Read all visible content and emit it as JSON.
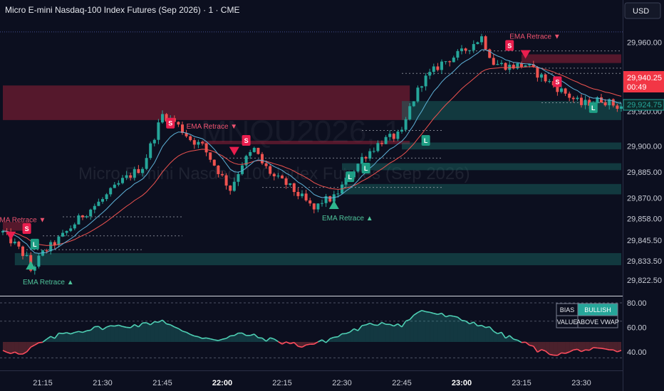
{
  "header": {
    "title": "Micro E-mini Nasdaq-100 Index Futures (Sep 2026) · 1 · CME",
    "currency": "USD",
    "watermark_symbol": "MNQU2026, 1",
    "watermark_name": "Micro E-mini Nasdaq-100 Index Futures (Sep 2026)"
  },
  "price_panel": {
    "last_price": "29,940.25",
    "countdown": "00:49",
    "ema_value": "29,924.75"
  },
  "status_table": {
    "bias_label": "BIAS",
    "bias_value": "BULLISH",
    "value_label": "VALUE",
    "value_value": "ABOVE VWAP"
  },
  "colors": {
    "background": "#0c0f1f",
    "bull": "#26a69a",
    "bear": "#ef5350",
    "signal_sell": "#e91e4e",
    "signal_buy": "#1e9e84",
    "ema_fast": "#5fb3d9",
    "ema_slow": "#ef5350"
  },
  "chart_data": {
    "type": "candlestick",
    "price_axis": {
      "ylim": [
        29815,
        29968
      ],
      "ticks": [
        29960,
        29940.25,
        29924.75,
        29920,
        29900,
        29885,
        29870,
        29858,
        29845.5,
        29833.5,
        29822.5
      ],
      "tick_labels": [
        "29,960.00",
        "29,940.25",
        "29,924.75",
        "29,920.00",
        "29,900.00",
        "29,885.00",
        "29,870.00",
        "29,858.00",
        "29,845.50",
        "29,833.50",
        "29,822.50"
      ]
    },
    "time_axis": {
      "xlim": [
        "21:05",
        "23:40"
      ],
      "ticks": [
        "21:15",
        "21:30",
        "21:45",
        "22:00",
        "22:15",
        "22:30",
        "22:45",
        "23:00",
        "23:15",
        "23:30"
      ],
      "bold_ticks": [
        "22:00",
        "23:00"
      ]
    },
    "waypoints": [
      [
        "21:05",
        29850
      ],
      [
        "21:08",
        29843
      ],
      [
        "21:11",
        29835
      ],
      [
        "21:12",
        29828
      ],
      [
        "21:15",
        29838
      ],
      [
        "21:20",
        29848
      ],
      [
        "21:25",
        29860
      ],
      [
        "21:30",
        29869
      ],
      [
        "21:35",
        29880
      ],
      [
        "21:40",
        29888
      ],
      [
        "21:43",
        29906
      ],
      [
        "21:45",
        29918
      ],
      [
        "21:48",
        29914
      ],
      [
        "21:52",
        29904
      ],
      [
        "21:55",
        29900
      ],
      [
        "22:00",
        29882
      ],
      [
        "22:02",
        29875
      ],
      [
        "22:05",
        29890
      ],
      [
        "22:08",
        29898
      ],
      [
        "22:10",
        29890
      ],
      [
        "22:13",
        29882
      ],
      [
        "22:16",
        29878
      ],
      [
        "22:20",
        29870
      ],
      [
        "22:23",
        29863
      ],
      [
        "22:25",
        29868
      ],
      [
        "22:28",
        29870
      ],
      [
        "22:31",
        29880
      ],
      [
        "22:35",
        29893
      ],
      [
        "22:40",
        29903
      ],
      [
        "22:45",
        29907
      ],
      [
        "22:47",
        29922
      ],
      [
        "22:50",
        29937
      ],
      [
        "22:55",
        29948
      ],
      [
        "23:00",
        29954
      ],
      [
        "23:05",
        29963
      ],
      [
        "23:08",
        29948
      ],
      [
        "23:12",
        29946
      ],
      [
        "23:16",
        29947
      ],
      [
        "23:20",
        29940
      ],
      [
        "23:25",
        29932
      ],
      [
        "23:30",
        29924
      ],
      [
        "23:35",
        29927
      ],
      [
        "23:39",
        29923
      ]
    ],
    "zones": [
      {
        "kind": "supply",
        "from": "21:05",
        "to": "22:47",
        "price_high": 29935,
        "price_low": 29915
      },
      {
        "kind": "supply",
        "from": "21:05",
        "to": "21:12",
        "price_high": 29856,
        "price_low": 29851
      },
      {
        "kind": "supply",
        "from": "21:55",
        "to": "22:47",
        "price_high": 29903,
        "price_low": 29901
      },
      {
        "kind": "supply",
        "from": "23:15",
        "to": "23:40",
        "price_high": 29953,
        "price_low": 29948
      },
      {
        "kind": "demand",
        "from": "21:08",
        "to": "23:40",
        "price_high": 29838,
        "price_low": 29831
      },
      {
        "kind": "demand",
        "from": "22:45",
        "to": "23:40",
        "price_high": 29926,
        "price_low": 29915
      },
      {
        "kind": "demand",
        "from": "22:45",
        "to": "23:40",
        "price_high": 29902,
        "price_low": 29898
      },
      {
        "kind": "demand",
        "from": "22:30",
        "to": "23:40",
        "price_high": 29890,
        "price_low": 29886
      },
      {
        "kind": "demand",
        "from": "22:30",
        "to": "23:40",
        "price_high": 29878,
        "price_low": 29872
      }
    ],
    "signals": [
      {
        "type": "S",
        "time": "21:11",
        "price": 29852
      },
      {
        "type": "L",
        "time": "21:13",
        "price": 29843
      },
      {
        "type": "S",
        "time": "21:47",
        "price": 29913
      },
      {
        "type": "S",
        "time": "22:06",
        "price": 29903
      },
      {
        "type": "L",
        "time": "22:32",
        "price": 29882
      },
      {
        "type": "L",
        "time": "22:36",
        "price": 29887
      },
      {
        "type": "L",
        "time": "22:51",
        "price": 29903
      },
      {
        "type": "S",
        "time": "23:12",
        "price": 29958
      },
      {
        "type": "S",
        "time": "23:24",
        "price": 29937
      },
      {
        "type": "L",
        "time": "23:33",
        "price": 29922
      }
    ],
    "retrace_labels": [
      {
        "text": "EMA Retrace ▼",
        "time": "23:12",
        "price": 29962,
        "kind": "bear"
      },
      {
        "text": "EMA Retrace ▼",
        "time": "21:51",
        "price": 29910,
        "kind": "bear"
      },
      {
        "text": "EMA Retrace ▼",
        "time": "21:03",
        "price": 29856,
        "kind": "bear"
      },
      {
        "text": "EMA Retrace ▲",
        "time": "22:25",
        "price": 29857,
        "kind": "bull"
      },
      {
        "text": "EMA Retrace ▲",
        "time": "21:10",
        "price": 29820,
        "kind": "bull"
      }
    ],
    "triangles": [
      {
        "dir": "down",
        "time": "23:16",
        "price": 29953
      },
      {
        "dir": "down",
        "time": "22:03",
        "price": 29897
      },
      {
        "dir": "down",
        "time": "21:07",
        "price": 29848
      },
      {
        "dir": "up",
        "time": "22:28",
        "price": 29866
      },
      {
        "dir": "up",
        "time": "21:12",
        "price": 29831
      }
    ],
    "oscillator": {
      "ylim": [
        30,
        80
      ],
      "ticks": [
        80,
        60,
        40
      ],
      "tick_labels": [
        "80.00",
        "60.00",
        "40.00"
      ],
      "level_lines": [
        80,
        65,
        35
      ],
      "waypoints": [
        [
          "21:05",
          42
        ],
        [
          "21:10",
          37
        ],
        [
          "21:13",
          45
        ],
        [
          "21:20",
          55
        ],
        [
          "21:30",
          60
        ],
        [
          "21:40",
          62
        ],
        [
          "21:45",
          66
        ],
        [
          "21:50",
          56
        ],
        [
          "21:55",
          52
        ],
        [
          "22:00",
          50
        ],
        [
          "22:05",
          55
        ],
        [
          "22:10",
          51
        ],
        [
          "22:15",
          48
        ],
        [
          "22:20",
          45
        ],
        [
          "22:25",
          48
        ],
        [
          "22:30",
          54
        ],
        [
          "22:35",
          60
        ],
        [
          "22:40",
          64
        ],
        [
          "22:45",
          62
        ],
        [
          "22:50",
          74
        ],
        [
          "22:55",
          70
        ],
        [
          "23:00",
          66
        ],
        [
          "23:05",
          62
        ],
        [
          "23:10",
          54
        ],
        [
          "23:15",
          48
        ],
        [
          "23:20",
          40
        ],
        [
          "23:25",
          38
        ],
        [
          "23:30",
          42
        ],
        [
          "23:35",
          41
        ],
        [
          "23:39",
          40
        ]
      ]
    }
  }
}
